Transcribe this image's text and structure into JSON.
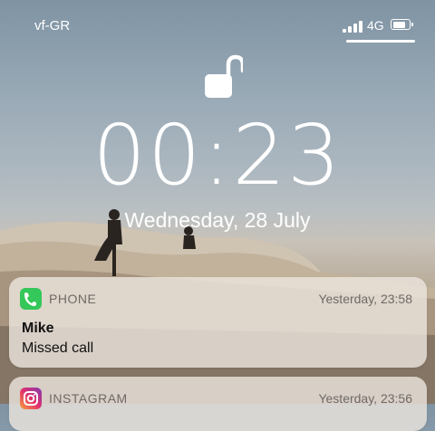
{
  "status_bar": {
    "carrier": "vf-GR",
    "network": "4G",
    "battery_level": 0.75
  },
  "lock_screen": {
    "time": "00:23",
    "date": "Wednesday, 28 July"
  },
  "notifications": [
    {
      "app": "PHONE",
      "time": "Yesterday, 23:58",
      "title": "Mike",
      "body": "Missed call",
      "icon": "phone-icon"
    },
    {
      "app": "INSTAGRAM",
      "time": "Yesterday, 23:56",
      "icon": "instagram-icon"
    }
  ]
}
